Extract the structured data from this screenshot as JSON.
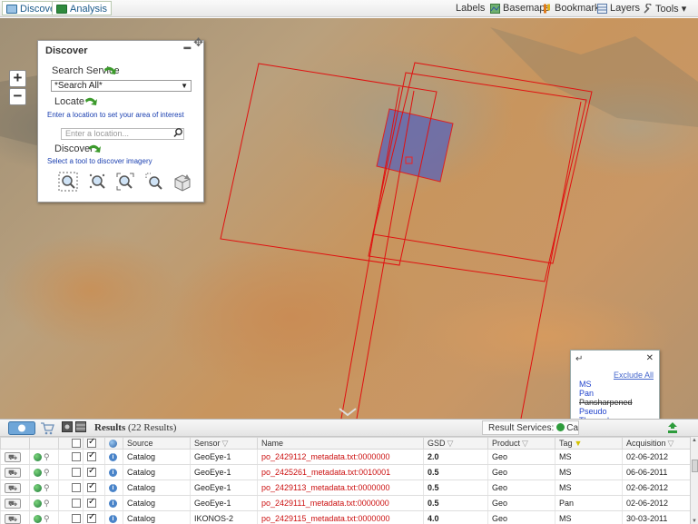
{
  "topbar": {
    "tabs": [
      {
        "label": "Discover",
        "icon": "discover-icon"
      },
      {
        "label": "Analysis",
        "icon": "analysis-icon"
      }
    ],
    "tools": [
      {
        "label": "Labels"
      },
      {
        "label": "Basemaps",
        "icon": "basemaps-icon"
      },
      {
        "label": "Bookmarks",
        "icon": "bookmarks-icon"
      },
      {
        "label": "Layers",
        "icon": "layers-icon"
      },
      {
        "label": "Tools ▾",
        "icon": "wrench-icon"
      }
    ]
  },
  "map": {
    "zoom_in": "+",
    "zoom_out": "−"
  },
  "discover": {
    "title": "Discover",
    "search_service_label": "Search Service",
    "search_service_value": "*Search All*",
    "locate_label": "Locate",
    "locate_hint": "Enter a location to set your area of interest",
    "location_placeholder": "Enter a location...",
    "discover_label": "Discover",
    "discover_hint": "Select a tool to discover imagery"
  },
  "tag_filter": {
    "exclude_all": "Exclude All",
    "options": [
      {
        "label": "MS",
        "included": true
      },
      {
        "label": "Pan",
        "included": true
      },
      {
        "label": "Pansharpened",
        "included": false
      },
      {
        "label": "Pseudo",
        "included": true
      },
      {
        "label": "Thermal",
        "included": true
      }
    ]
  },
  "results": {
    "title": "Results",
    "count": "(22 Results)",
    "services_label": "Result Services:",
    "services_value": "Catal",
    "columns": [
      "Source",
      "Sensor",
      "Name",
      "GSD",
      "Product",
      "Tag",
      "Acquisition"
    ],
    "rows": [
      {
        "checked": true,
        "source": "Catalog",
        "sensor": "GeoEye-1",
        "name": "po_2429112_metadata.txt:0000000",
        "gsd": "2.0",
        "product": "Geo",
        "tag": "MS",
        "acquisition": "02-06-2012"
      },
      {
        "checked": true,
        "source": "Catalog",
        "sensor": "GeoEye-1",
        "name": "po_2425261_metadata.txt:0010001",
        "gsd": "0.5",
        "product": "Geo",
        "tag": "MS",
        "acquisition": "06-06-2011"
      },
      {
        "checked": true,
        "source": "Catalog",
        "sensor": "GeoEye-1",
        "name": "po_2429113_metadata.txt:0000000",
        "gsd": "0.5",
        "product": "Geo",
        "tag": "MS",
        "acquisition": "02-06-2012"
      },
      {
        "checked": true,
        "source": "Catalog",
        "sensor": "GeoEye-1",
        "name": "po_2429111_metadata.txt:0000000",
        "gsd": "0.5",
        "product": "Geo",
        "tag": "Pan",
        "acquisition": "02-06-2012"
      },
      {
        "checked": true,
        "source": "Catalog",
        "sensor": "IKONOS-2",
        "name": "po_2429115_metadata.txt:0000000",
        "gsd": "4.0",
        "product": "Geo",
        "tag": "MS",
        "acquisition": "30-03-2011"
      }
    ]
  }
}
